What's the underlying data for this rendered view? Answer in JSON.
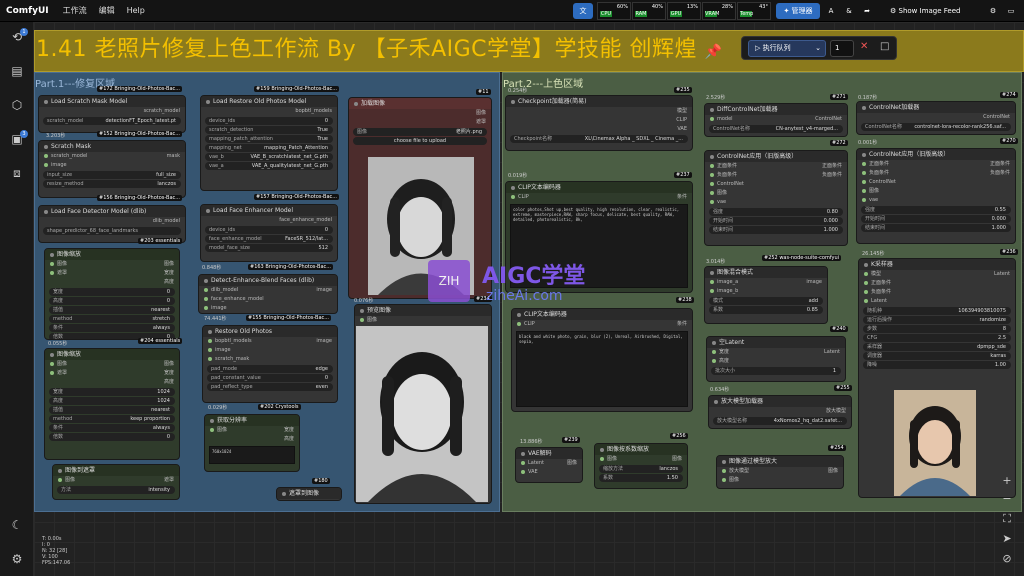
{
  "app": {
    "name": "ComfyUI",
    "menus": [
      "工作流",
      "编辑",
      "Help"
    ]
  },
  "monitors": [
    {
      "label": "CPU",
      "value": "60%"
    },
    {
      "label": "RAM",
      "value": "40%"
    },
    {
      "label": "GPU",
      "value": "13%"
    },
    {
      "label": "VRAM",
      "value": "28%"
    },
    {
      "label": "Temp",
      "value": "43°"
    }
  ],
  "toolbar": {
    "manager": "管理器",
    "feed": "Show Image Feed",
    "feed_icon": "⚙"
  },
  "title": "1.41 老照片修复上色工作流 By 【子禾AIGC学堂】学技能 创辉煌",
  "queue": {
    "label": "执行队列",
    "count": "1"
  },
  "groups": {
    "part1": "Part.1---修复区域",
    "part2": "Part.2---上色区域"
  },
  "nodes": {
    "scratch_mask_model": {
      "id": "#172 Bringing-Old-Photos-Bac...",
      "title": "Load Scratch Mask Model",
      "out": "scratch_model",
      "w": [
        {
          "k": "scratch_model",
          "v": "detectionFT_Epoch_latest.pt"
        }
      ],
      "time": "3.203秒"
    },
    "scratch_mask": {
      "id": "#152 Bringing-Old-Photos-Bac...",
      "title": "Scratch Mask",
      "in": [
        "scratch_model",
        "image"
      ],
      "out": "mask",
      "w": [
        {
          "k": "input_size",
          "v": "full_size"
        },
        {
          "k": "resize_method",
          "v": "lanczos"
        }
      ]
    },
    "face_detector": {
      "id": "#156 Bringing-Old-Photos-Bac...",
      "title": "Load Face Detector Model (dlib)",
      "out": "dlib_model",
      "w": [
        {
          "k": "shape_predictor_68_face_landmarks",
          "v": ""
        }
      ]
    },
    "image_scale1": {
      "id": "#203 essentials",
      "title": "图像缩放",
      "in": [
        "图像",
        "遮罩"
      ],
      "outs": [
        "图像",
        "宽度",
        "高度"
      ],
      "w": [
        {
          "k": "宽度",
          "v": "0"
        },
        {
          "k": "高度",
          "v": "0"
        },
        {
          "k": "插值",
          "v": "nearest"
        },
        {
          "k": "method",
          "v": "stretch"
        },
        {
          "k": "条件",
          "v": "always"
        },
        {
          "k": "倍数",
          "v": "0"
        }
      ],
      "time": "0.055秒"
    },
    "image_scale2": {
      "id": "#204 essentials",
      "title": "图像缩放",
      "in": [
        "图像",
        "遮罩"
      ],
      "outs": [
        "图像",
        "宽度",
        "高度"
      ],
      "w": [
        {
          "k": "宽度",
          "v": "1024"
        },
        {
          "k": "高度",
          "v": "1024"
        },
        {
          "k": "插值",
          "v": "nearest"
        },
        {
          "k": "method",
          "v": "keep proportion"
        },
        {
          "k": "条件",
          "v": "always"
        },
        {
          "k": "倍数",
          "v": "0"
        }
      ]
    },
    "img_to_mask": {
      "title": "图像到遮罩",
      "in": [
        "图像"
      ],
      "out": "遮罩",
      "w": [
        {
          "k": "方法",
          "v": "intensity"
        }
      ]
    },
    "restore_old_photos_model": {
      "id": "#159 Bringing-Old-Photos-Bac...",
      "title": "Load Restore Old Photos Model",
      "out": "bopbtl_models",
      "w": [
        {
          "k": "device_ids",
          "v": "0"
        },
        {
          "k": "scratch_detection",
          "v": "True"
        },
        {
          "k": "mapping_patch_attention",
          "v": "True"
        },
        {
          "k": "mapping_net",
          "v": "mapping_Patch_Attention"
        },
        {
          "k": "vae_b",
          "v": "VAE_B_scratchlatest_net_G.pth"
        },
        {
          "k": "vae_a",
          "v": "VAE_A_qualitylatest_net_G.pth"
        }
      ]
    },
    "face_enhancer": {
      "id": "#157 Bringing-Old-Photos-Bac...",
      "title": "Load Face Enhancer Model",
      "out": "face_enhance_model",
      "w": [
        {
          "k": "device_ids",
          "v": "0"
        },
        {
          "k": "face_enhance_model",
          "v": "FaceSR_512/lat..."
        },
        {
          "k": "model_face_size",
          "v": "512"
        }
      ],
      "time": "0.848秒"
    },
    "enhance_blend": {
      "id": "#163 Bringing-Old-Photos-Bac...",
      "title": "Detect-Enhance-Blend Faces (dlib)",
      "in": [
        "dlib_model",
        "face_enhance_model",
        "image"
      ],
      "out": "image",
      "time": "74.441秒"
    },
    "restore_old_photos": {
      "id": "#155 Bringing-Old-Photos-Bac...",
      "title": "Restore Old Photos",
      "in": [
        "bopbtl_models",
        "image",
        "scratch_mask"
      ],
      "out": "image",
      "w": [
        {
          "k": "pad_mode",
          "v": "edge"
        },
        {
          "k": "pad_constant_value",
          "v": "0"
        },
        {
          "k": "pad_reflect_type",
          "v": "even"
        }
      ],
      "time": "0.029秒"
    },
    "get_size": {
      "id": "#202 Crystools",
      "title": "获取分辨率",
      "in": [
        "图像"
      ],
      "outs": [
        "宽度",
        "高度"
      ],
      "text": "760x1024"
    },
    "preview_mask": {
      "id": "#180",
      "title": "遮罩到图像"
    },
    "load_image": {
      "id": "#11",
      "title": "加载图像",
      "outs": [
        "图像",
        "遮罩"
      ],
      "w": [
        {
          "k": "图像",
          "v": "老照片.png"
        }
      ],
      "upload": "choose file to upload"
    },
    "preview_image": {
      "id": "#234",
      "title": "预览图像",
      "in": [
        "图像"
      ],
      "time": "0.076秒"
    },
    "checkpoint": {
      "id": "#235",
      "title": "Checkpoint加载器(简易)",
      "outs": [
        "模型",
        "CLIP",
        "VAE"
      ],
      "w": [
        {
          "k": "Checkpoint名称",
          "v": "XL\\Cinemax Alpha _ SDXL _ Cinema _..."
        }
      ],
      "time": "0.254秒"
    },
    "clip_pos": {
      "id": "#237",
      "title": "CLIP文本编码器",
      "in": [
        "CLIP"
      ],
      "out": "条件",
      "text": "color photos,Shot up,best quality, high resolution, clear, realistic, extreme, masterpiece,RAW, sharp focus, delicate, best quality, RAW, detailed, photorealistic, 8k,",
      "time": "0.019秒"
    },
    "clip_neg": {
      "id": "#238",
      "title": "CLIP文本编码器",
      "in": [
        "CLIP"
      ],
      "out": "条件",
      "text": "black and white photo, grain, blur (2), Unreal, Airbrushed, Digital, sepia,"
    },
    "vae_decode": {
      "id": "#239",
      "title": "VAE解码",
      "in": [
        "Latent",
        "VAE"
      ],
      "out": "图像",
      "time": "13.886秒"
    },
    "scale_by": {
      "id": "#256",
      "title": "图像按系数缩放",
      "in": [
        "图像"
      ],
      "out": "图像",
      "w": [
        {
          "k": "缩放方法",
          "v": "lanczos"
        },
        {
          "k": "系数",
          "v": "1.50"
        }
      ]
    },
    "diff_controlnet": {
      "id": "#271",
      "title": "DiffControlNet加载器",
      "in": [
        "model"
      ],
      "out": "ControlNet",
      "w": [
        {
          "k": "ControlNet名称",
          "v": "CN-anytest_v4-marged..."
        }
      ],
      "time": "2.529秒"
    },
    "cn_apply1": {
      "id": "#272",
      "title": "ControlNet应用（旧版高级）",
      "in": [
        "正面条件",
        "负面条件",
        "ControlNet",
        "图像",
        "vae"
      ],
      "outs": [
        "正面条件",
        "负面条件"
      ],
      "w": [
        {
          "k": "强度",
          "v": "0.80"
        },
        {
          "k": "开始时间",
          "v": "0.000"
        },
        {
          "k": "结束时间",
          "v": "1.000"
        }
      ]
    },
    "img_blend": {
      "id": "#252 was-node-suite-comfyui",
      "title": "图像混合模式",
      "in": [
        "image_a",
        "image_b"
      ],
      "out": "image",
      "w": [
        {
          "k": "模式",
          "v": "add"
        },
        {
          "k": "系数",
          "v": "0.85"
        }
      ],
      "time": "3.014秒"
    },
    "empty_latent": {
      "id": "#240",
      "title": "空Latent",
      "in": [
        "宽度",
        "高度"
      ],
      "out": "Latent",
      "w": [
        {
          "k": "批次大小",
          "v": "1"
        }
      ]
    },
    "upscale_loader": {
      "id": "#255",
      "title": "放大模型加载器",
      "out": "放大模型",
      "w": [
        {
          "k": "放大模型名称",
          "v": "4xNomos2_hq_dat2.safet..."
        }
      ],
      "time": "0.634秒"
    },
    "upscale_by_model": {
      "id": "#254",
      "title": "图像通过模型放大",
      "in": [
        "放大模型",
        "图像"
      ],
      "out": "图像"
    },
    "controlnet_loader": {
      "id": "#274",
      "title": "ControlNet加载器",
      "out": "ControlNet",
      "w": [
        {
          "k": "ControlNet名称",
          "v": "controlnet-lora-recolor-rank256.saf..."
        }
      ],
      "time": "0.187秒"
    },
    "cn_apply2": {
      "id": "#270",
      "title": "ControlNet应用（旧版高级）",
      "in": [
        "正面条件",
        "负面条件",
        "ControlNet",
        "图像",
        "vae"
      ],
      "outs": [
        "正面条件",
        "负面条件"
      ],
      "w": [
        {
          "k": "强度",
          "v": "0.55"
        },
        {
          "k": "开始时间",
          "v": "0.000"
        },
        {
          "k": "结束时间",
          "v": "1.000"
        }
      ],
      "time": "0.001秒"
    },
    "ksampler": {
      "id": "#236",
      "title": "K采样器",
      "in": [
        "模型",
        "正面条件",
        "负面条件",
        "Latent"
      ],
      "out": "Latent",
      "w": [
        {
          "k": "随机种",
          "v": "106394903810075"
        },
        {
          "k": "运行后操作",
          "v": "randomize"
        },
        {
          "k": "步数",
          "v": "8"
        },
        {
          "k": "CFG",
          "v": "2.5"
        },
        {
          "k": "采样器",
          "v": "dpmpp_sde"
        },
        {
          "k": "调度器",
          "v": "karras"
        },
        {
          "k": "降噪",
          "v": "1.00"
        }
      ],
      "time": "26.145秒"
    }
  },
  "watermark": {
    "line1": "AIGC学堂",
    "line2": "ziheAi.com"
  },
  "stats": [
    "T: 0.00s",
    "I: 0",
    "N: 32 [28]",
    "V: 100",
    "FPS:147.06"
  ],
  "colors": {
    "part1": "#365571",
    "part2": "#4b5e44",
    "title_bg": "#8b7a1c",
    "title_text": "#f4c000",
    "accent": "#3d7bd6"
  }
}
